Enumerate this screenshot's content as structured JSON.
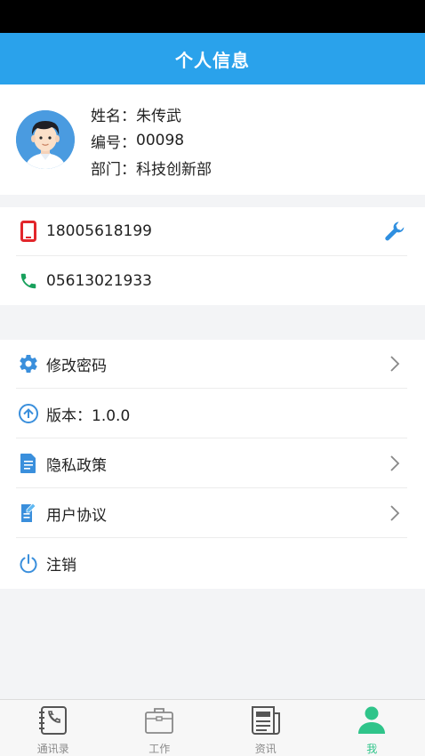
{
  "header": {
    "title": "个人信息"
  },
  "profile": {
    "name_label": "姓名：",
    "name_value": "朱传武",
    "id_label": "编号：",
    "id_value": "00098",
    "dept_label": "部门：",
    "dept_value": "科技创新部"
  },
  "contacts": {
    "mobile": "18005618199",
    "phone": "05613021933",
    "mobile_icon": "mobile-phone-icon",
    "phone_icon": "telephone-icon",
    "edit_icon": "wrench-icon"
  },
  "menu": [
    {
      "label": "修改密码",
      "icon": "gear-icon",
      "has_arrow": true
    },
    {
      "label": "版本：1.0.0",
      "icon": "upgrade-icon",
      "has_arrow": false
    },
    {
      "label": "隐私政策",
      "icon": "document-icon",
      "has_arrow": true
    },
    {
      "label": "用户协议",
      "icon": "edit-document-icon",
      "has_arrow": true
    },
    {
      "label": "注销",
      "icon": "power-icon",
      "has_arrow": false
    }
  ],
  "tabs": [
    {
      "label": "通讯录",
      "icon": "contacts-book-icon",
      "active": false
    },
    {
      "label": "工作",
      "icon": "briefcase-icon",
      "active": false
    },
    {
      "label": "资讯",
      "icon": "news-icon",
      "active": false
    },
    {
      "label": "我",
      "icon": "person-icon",
      "active": true
    }
  ],
  "colors": {
    "header_bg": "#2aa2eb",
    "accent_blue": "#3a8fdc",
    "mobile_red": "#e2262b",
    "phone_green": "#18a05c",
    "tab_active": "#2fc48a",
    "tab_inactive": "#8a8a8a"
  }
}
